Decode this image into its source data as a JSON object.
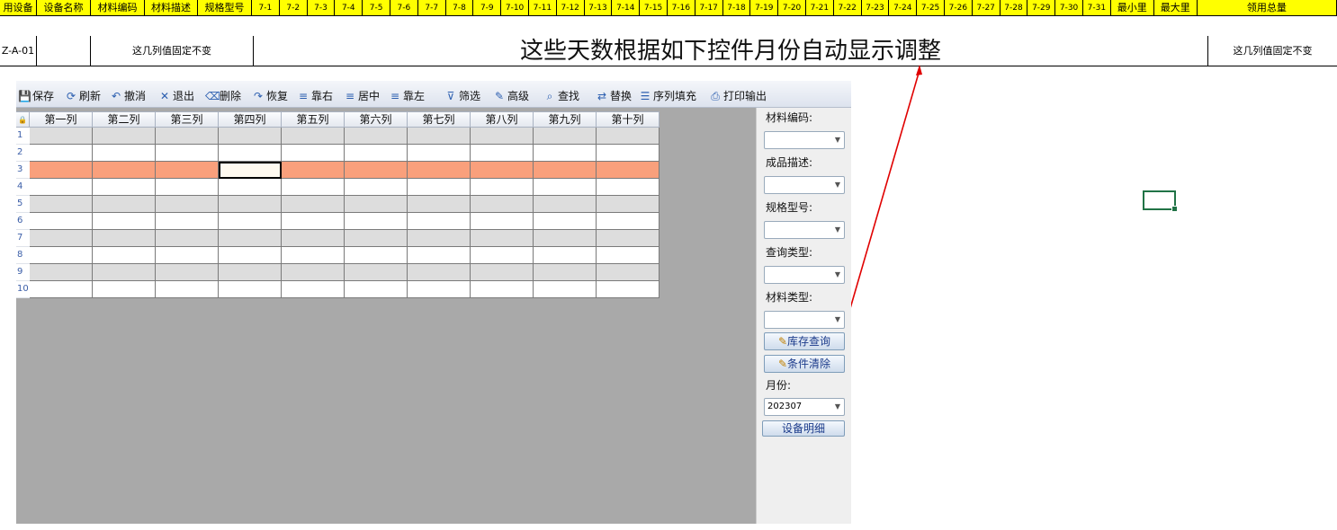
{
  "sheet": {
    "header_cells": [
      "用设备",
      "设备名称",
      "材料编码",
      "材料描述",
      "规格型号",
      "7-1",
      "7-2",
      "7-3",
      "7-4",
      "7-5",
      "7-6",
      "7-7",
      "7-8",
      "7-9",
      "7-10",
      "7-11",
      "7-12",
      "7-13",
      "7-14",
      "7-15",
      "7-16",
      "7-17",
      "7-18",
      "7-19",
      "7-20",
      "7-21",
      "7-22",
      "7-23",
      "7-24",
      "7-25",
      "7-26",
      "7-27",
      "7-28",
      "7-29",
      "7-30",
      "7-31",
      "最小里",
      "最大里",
      "领用总量"
    ],
    "row2": {
      "col_a": "Z-A-01",
      "note_left": "这几列值固定不变",
      "note_right": "这几列值固定不变",
      "big_note": "这些天数根据如下控件月份自动显示调整"
    },
    "header_color": "#ffff00"
  },
  "form": {
    "toolbar": [
      {
        "icon": "save-icon",
        "label": "保存"
      },
      {
        "icon": "refresh-icon",
        "label": "刷新"
      },
      {
        "icon": "undo-icon",
        "label": "撤消"
      },
      {
        "icon": "exit-icon",
        "label": "退出"
      },
      {
        "icon": "delete-icon",
        "label": "删除"
      },
      {
        "icon": "restore-icon",
        "label": "恢复"
      },
      {
        "icon": "align-right-icon",
        "label": "靠右"
      },
      {
        "icon": "align-center-icon",
        "label": "居中"
      },
      {
        "icon": "align-left-icon",
        "label": "靠左"
      },
      {
        "icon": "filter-icon",
        "label": "筛选"
      },
      {
        "icon": "advanced-icon",
        "label": "高级"
      },
      {
        "icon": "find-icon",
        "label": "查找"
      },
      {
        "icon": "replace-icon",
        "label": "替换"
      },
      {
        "icon": "sequence-fill-icon",
        "label": "序列填充"
      },
      {
        "icon": "print-icon",
        "label": "打印输出"
      }
    ],
    "grid": {
      "columns": [
        "第一列",
        "第二列",
        "第三列",
        "第四列",
        "第五列",
        "第六列",
        "第七列",
        "第八列",
        "第九列",
        "第十列"
      ],
      "rows": [
        "1",
        "2",
        "3",
        "4",
        "5",
        "6",
        "7",
        "8",
        "9",
        "10"
      ],
      "highlight_color": "#f9a07c",
      "alt_row_color": "#dddddd"
    },
    "side": {
      "material_code_label": "材料编码:",
      "product_desc_label": "成品描述:",
      "spec_label": "规格型号:",
      "query_type_label": "查询类型:",
      "material_type_label": "材料类型:",
      "stock_query_button": "库存查询",
      "clear_button": "条件清除",
      "month_label": "月份:",
      "month_value": "202307",
      "equipment_detail_button": "设备明细"
    }
  }
}
